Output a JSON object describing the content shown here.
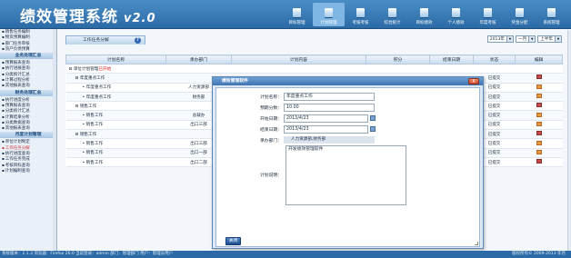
{
  "app": {
    "title": "绩效管理系统",
    "version": "v2.0"
  },
  "nav": [
    "目标管理",
    "计划管理",
    "考核考核",
    "综合统计",
    "目标绩效",
    "个人绩效",
    "年度考核",
    "奖金分配",
    "系统管理"
  ],
  "nav_active": 1,
  "sidebar": {
    "top_items": [
      "销售任务编制",
      "物资预算编制",
      "部门任务审核",
      "资产负债预算"
    ],
    "group1": "业务处理汇总",
    "group1_items": [
      "预算报表查询",
      "执行进展查询",
      "分类统计汇总",
      "计算过程分析",
      "其他报表查询"
    ],
    "group2": "财务处理汇总",
    "group2_items": [
      "执行进度分析",
      "预算报表查询",
      "分类统计汇总",
      "计算结果分析",
      "分类数据查询",
      "其他报表查询"
    ],
    "group3": "月度计划管理",
    "group3_items": [
      "单位计划制定",
      "工作任务分解",
      "执行进度查询",
      "工作任务完成",
      "考核目标查询",
      "计划编制查询"
    ]
  },
  "panel": {
    "tab_label": "工作任务分解",
    "help_icon": "?"
  },
  "date_filter": {
    "year": "2013年",
    "month": "一月",
    "half": "上半年"
  },
  "table": {
    "columns": [
      "计划名称",
      "承办部门",
      "计划内容",
      "积分",
      "结束日期",
      "状态",
      "编辑"
    ],
    "group_name": "单位计划管理",
    "group_tag": "已开始",
    "rows": [
      {
        "name": "年度重点工作",
        "dept": "",
        "status": "已提交",
        "indent": 1,
        "toggle": "⊟"
      },
      {
        "name": "年度重点工作",
        "dept": "人力资源部",
        "status": "已提交",
        "indent": 2,
        "toggle": "•"
      },
      {
        "name": "年度重点工作",
        "dept": "财务部",
        "status": "已提交",
        "indent": 2,
        "toggle": "•"
      },
      {
        "name": "销售工作",
        "dept": "",
        "status": "已提交",
        "indent": 1,
        "toggle": "⊟"
      },
      {
        "name": "销售工作",
        "dept": "总裁办",
        "status": "已提交",
        "indent": 2,
        "toggle": "•"
      },
      {
        "name": "销售工作",
        "dept": "出口三部",
        "status": "已提交",
        "indent": 2,
        "toggle": "•"
      },
      {
        "name": "销售工作",
        "dept": "",
        "status": "已提交",
        "indent": 1,
        "toggle": "⊟"
      },
      {
        "name": "销售工作",
        "dept": "出口三部",
        "status": "已提交",
        "indent": 2,
        "toggle": "•"
      },
      {
        "name": "销售工作",
        "dept": "出口一部",
        "status": "已提交",
        "indent": 2,
        "toggle": "•"
      },
      {
        "name": "销售工作",
        "dept": "出口二部",
        "status": "已提交",
        "indent": 2,
        "toggle": "•"
      }
    ]
  },
  "dialog": {
    "title": "绩效管理软件",
    "close": "X",
    "labels": {
      "plan_name": "计划名称：",
      "score": "预期分数：",
      "start": "开始日期：",
      "end": "结束日期：",
      "dept": "承办部门：",
      "desc": "计划说明："
    },
    "values": {
      "plan_name": "年度重点工作",
      "score": "10.00",
      "start": "2013/4/23",
      "end": "2013/4/23",
      "dept": "人力资源部,财务部",
      "desc": "开发绩效管理软件"
    },
    "save_label": "关闭"
  },
  "footer": {
    "left": "系统版本：2.1.3  浏览器：Firefox 26.0  当前登录：admin  部门：管理部门  用户：管理员用户",
    "right": "版权所有©  2009-2013  年月"
  }
}
